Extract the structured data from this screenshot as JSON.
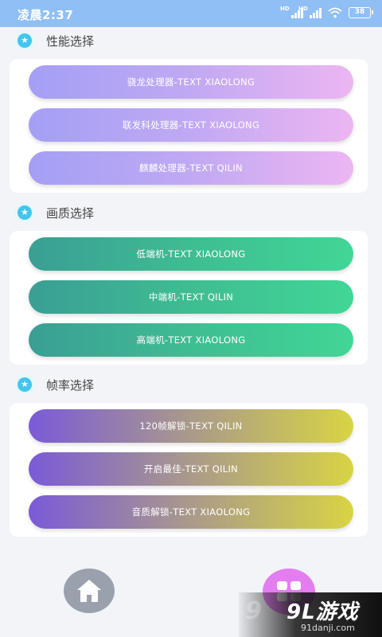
{
  "status_bar": {
    "time": "凌晨2:37",
    "battery": "38",
    "signal_label": "HD"
  },
  "sections": [
    {
      "title": "性能选择",
      "buttons": [
        "骁龙处理器-TEXT XIAOLONG",
        "联发科处理器-TEXT XIAOLONG",
        "麒麟处理器-TEXT QILIN"
      ]
    },
    {
      "title": "画质选择",
      "buttons": [
        "低端机-TEXT XIAOLONG",
        "中端机-TEXT QILIN",
        "高端机-TEXT XIAOLONG"
      ]
    },
    {
      "title": "帧率选择",
      "buttons": [
        "120帧解锁-TEXT QILIN",
        "开启最佳-TEXT QILIN",
        "音质解锁-TEXT XIAOLONG"
      ]
    }
  ],
  "icons": {
    "section": "star-icon",
    "home": "home-icon",
    "apps": "grid-icon"
  },
  "colors": {
    "status_bar": "#8fbff5",
    "star": "#41c6ee",
    "home": "#9aa1ad",
    "apps": "#e37df0"
  },
  "watermark": {
    "logo": "9L游戏",
    "url": "91danji.com"
  }
}
